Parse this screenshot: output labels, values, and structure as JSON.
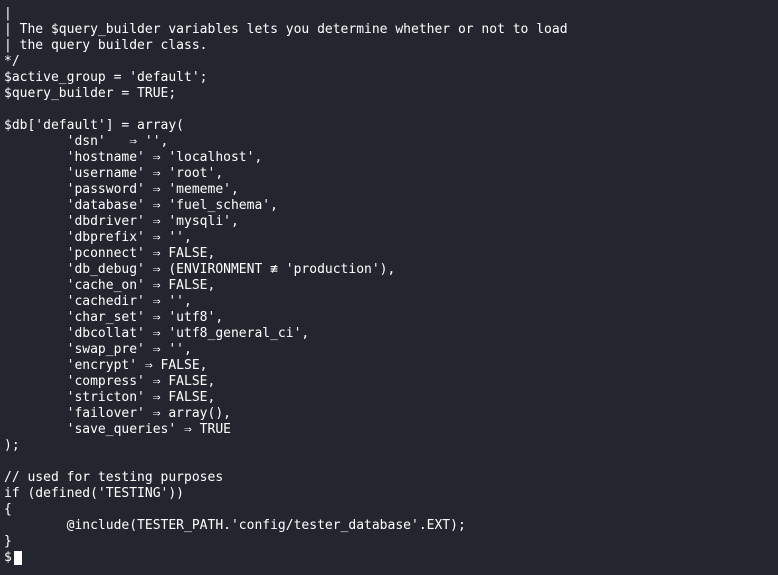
{
  "terminal": {
    "lines": [
      "|",
      "| The $query_builder variables lets you determine whether or not to load",
      "| the query builder class.",
      "*/",
      "$active_group = 'default';",
      "$query_builder = TRUE;",
      "",
      "$db['default'] = array(",
      "        'dsn'   ⇒ '',",
      "        'hostname' ⇒ 'localhost',",
      "        'username' ⇒ 'root',",
      "        'password' ⇒ 'mememe',",
      "        'database' ⇒ 'fuel_schema',",
      "        'dbdriver' ⇒ 'mysqli',",
      "        'dbprefix' ⇒ '',",
      "        'pconnect' ⇒ FALSE,",
      "        'db_debug' ⇒ (ENVIRONMENT ≢ 'production'),",
      "        'cache_on' ⇒ FALSE,",
      "        'cachedir' ⇒ '',",
      "        'char_set' ⇒ 'utf8',",
      "        'dbcollat' ⇒ 'utf8_general_ci',",
      "        'swap_pre' ⇒ '',",
      "        'encrypt' ⇒ FALSE,",
      "        'compress' ⇒ FALSE,",
      "        'stricton' ⇒ FALSE,",
      "        'failover' ⇒ array(),",
      "        'save_queries' ⇒ TRUE",
      ");",
      "",
      "// used for testing purposes",
      "if (defined('TESTING'))",
      "{",
      "        @include(TESTER_PATH.'config/tester_database'.EXT);",
      "}"
    ],
    "prompt": "$"
  },
  "colors": {
    "background": "#23262e",
    "text": "#ffffff"
  }
}
